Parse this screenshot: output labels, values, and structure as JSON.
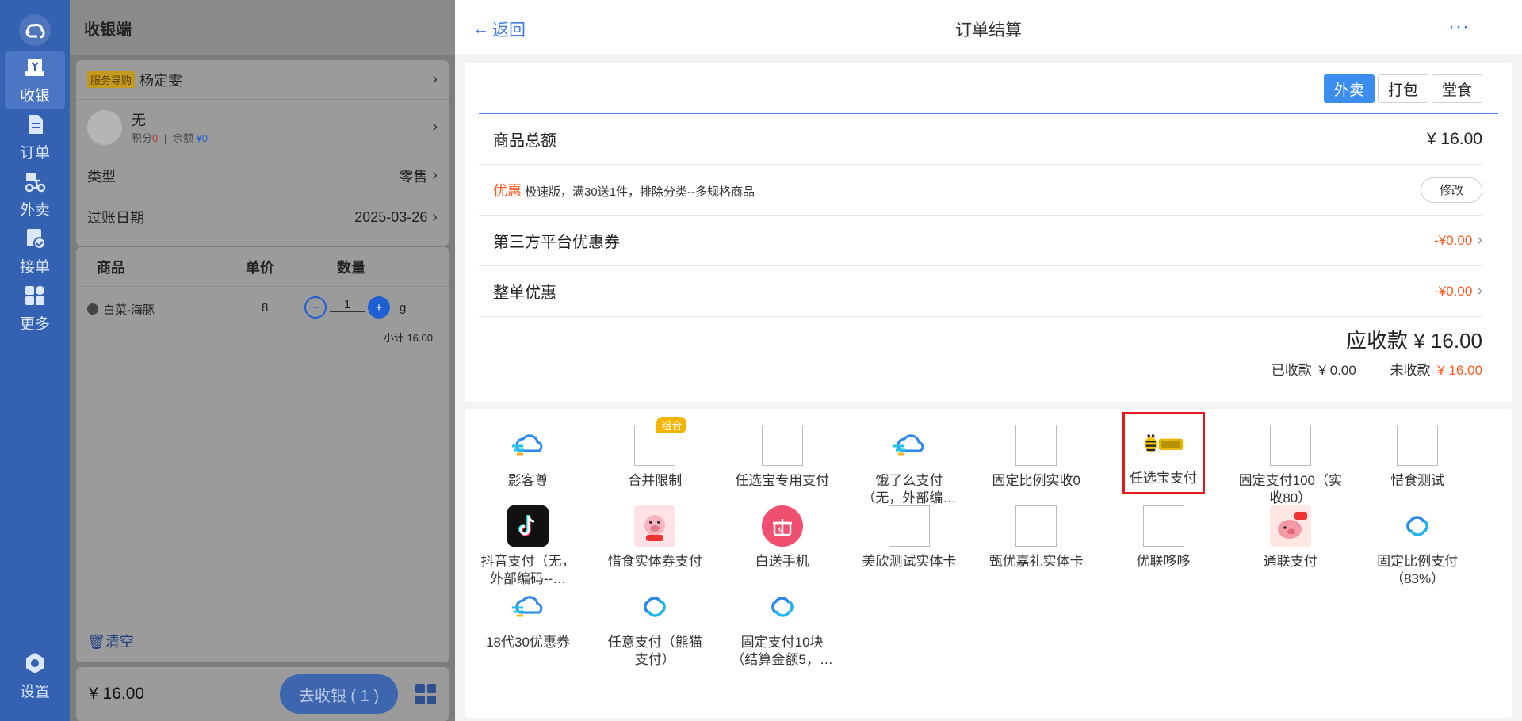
{
  "rail": {
    "items": [
      {
        "label": "收银",
        "icon": "cashier-icon",
        "active": true
      },
      {
        "label": "订单",
        "icon": "order-icon"
      },
      {
        "label": "外卖",
        "icon": "delivery-icon"
      },
      {
        "label": "接单",
        "icon": "accept-order-icon"
      },
      {
        "label": "更多",
        "icon": "grid-icon"
      }
    ],
    "settings_label": "设置"
  },
  "cashier": {
    "title": "收银端",
    "guide_tag": "服务导购",
    "guide_name": "杨定雯",
    "member_name": "无",
    "points_label": "积分",
    "points_value": "0",
    "sep": "|",
    "balance_label": "余额",
    "balance_value": "¥0",
    "type_label": "类型",
    "type_value": "零售",
    "date_label": "过账日期",
    "date_value": "2025-03-26",
    "col_product": "商品",
    "col_price": "单价",
    "col_qty": "数量",
    "item_name": "白菜-海豚",
    "item_price": "8",
    "item_qty": "1",
    "item_unit": "g",
    "item_subtotal": "小计 16.00",
    "clear_label": "清空",
    "total": "¥ 16.00",
    "checkout_label": "去收银 ( 1 )"
  },
  "header": {
    "back_label": "返回",
    "title": "订单结算",
    "more": "···"
  },
  "order_type": {
    "options": [
      "外卖",
      "打包",
      "堂食"
    ],
    "selected": "外卖"
  },
  "summary": {
    "goods_total_label": "商品总额",
    "goods_total_value": "¥ 16.00",
    "promo_label": "优惠",
    "promo_desc": "极速版，满30送1件，排除分类--多规格商品",
    "edit_label": "修改",
    "coupon_label": "第三方平台优惠券",
    "coupon_value": "-¥0.00",
    "order_discount_label": "整单优惠",
    "order_discount_value": "-¥0.00",
    "due_label": "应收款",
    "due_value": "¥ 16.00",
    "received_label": "已收款",
    "received_value": "¥ 0.00",
    "unpaid_label": "未收款",
    "unpaid_value": "¥ 16.00"
  },
  "payments": [
    {
      "name": "影客尊",
      "icon": "cloud-icon"
    },
    {
      "name": "合并限制",
      "icon": "broken-image-icon",
      "badge": "组合"
    },
    {
      "name": "任选宝专用支付",
      "icon": "broken-image-icon"
    },
    {
      "name": "饿了么支付（无，外部编…",
      "icon": "cloud-icon"
    },
    {
      "name": "固定比例实收0",
      "icon": "broken-image-icon"
    },
    {
      "name": "任选宝支付",
      "icon": "bee-logo-icon",
      "selected": true
    },
    {
      "name": "固定支付100（实收80）",
      "icon": "broken-image-icon"
    },
    {
      "name": "惜食测试",
      "icon": "broken-image-icon"
    },
    {
      "name": "抖音支付（无，外部编码--…",
      "icon": "tiktok-icon"
    },
    {
      "name": "惜食实体券支付",
      "icon": "pig-mascot-icon"
    },
    {
      "name": "白送手机",
      "icon": "gift-icon"
    },
    {
      "name": "美欣测试实体卡",
      "icon": "broken-image-icon"
    },
    {
      "name": "甄优嘉礼实体卡",
      "icon": "broken-image-icon"
    },
    {
      "name": "优联哆哆",
      "icon": "broken-image-icon"
    },
    {
      "name": "通联支付",
      "icon": "pig-card-icon"
    },
    {
      "name": "固定比例支付（83%）",
      "icon": "link-cloud-icon"
    },
    {
      "name": "18代30优惠券",
      "icon": "cloud-icon"
    },
    {
      "name": "任意支付（熊猫支付）",
      "icon": "link-cloud-icon"
    },
    {
      "name": "固定支付10块（结算金额5，…",
      "icon": "link-cloud-icon"
    }
  ],
  "colors": {
    "rail": "#3561b2",
    "accent": "#3c8df0",
    "negative": "#ff5a1f",
    "selected_border": "#e21b1b"
  }
}
